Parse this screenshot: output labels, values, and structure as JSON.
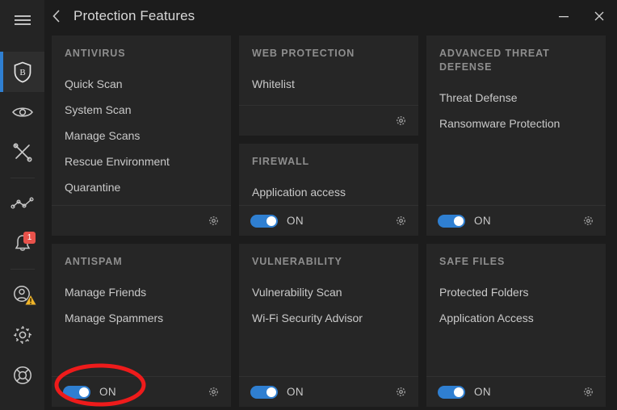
{
  "window": {
    "title": "Protection Features",
    "back_icon": "chevron-left-icon",
    "minimize_label": "—",
    "close_label": "✕",
    "bg_color": "#1c1c1c",
    "card_color": "#262626",
    "accent_color": "#2f7fd1",
    "annotation_color": "#ee1b1b"
  },
  "sidebar": {
    "menu_icon": "hamburger-menu-icon",
    "items": [
      {
        "name": "protection",
        "icon": "shield-b-icon",
        "active": true
      },
      {
        "name": "privacy",
        "icon": "eye-icon",
        "active": false
      },
      {
        "name": "utilities",
        "icon": "tools-icon",
        "active": false
      },
      {
        "name": "reports",
        "icon": "activity-chart-icon",
        "active": false
      },
      {
        "name": "notifications",
        "icon": "bell-icon",
        "active": false,
        "badge": "1"
      },
      {
        "name": "account",
        "icon": "account-warning-icon",
        "active": false
      },
      {
        "name": "settings",
        "icon": "gear-icon",
        "active": false
      },
      {
        "name": "support",
        "icon": "lifebuoy-icon",
        "active": false
      }
    ]
  },
  "cards": {
    "antivirus": {
      "title": "ANTIVIRUS",
      "links": [
        "Quick Scan",
        "System Scan",
        "Manage Scans",
        "Rescue Environment",
        "Quarantine"
      ],
      "has_toggle": false,
      "settings_icon": "gear-icon"
    },
    "antispam": {
      "title": "ANTISPAM",
      "links": [
        "Manage Friends",
        "Manage Spammers"
      ],
      "has_toggle": true,
      "toggle_state": "ON",
      "settings_icon": "gear-icon"
    },
    "web_protection": {
      "title": "WEB PROTECTION",
      "links": [
        "Whitelist"
      ],
      "has_toggle": false,
      "settings_icon": "gear-icon"
    },
    "firewall": {
      "title": "FIREWALL",
      "links": [
        "Application access"
      ],
      "has_toggle": true,
      "toggle_state": "ON",
      "settings_icon": "gear-icon"
    },
    "vulnerability": {
      "title": "VULNERABILITY",
      "links": [
        "Vulnerability Scan",
        "Wi-Fi Security Advisor"
      ],
      "has_toggle": true,
      "toggle_state": "ON",
      "settings_icon": "gear-icon"
    },
    "advanced_threat_defense": {
      "title": "ADVANCED THREAT DEFENSE",
      "links": [
        "Threat Defense",
        "Ransomware Protection"
      ],
      "has_toggle": true,
      "toggle_state": "ON",
      "settings_icon": "gear-icon"
    },
    "safe_files": {
      "title": "SAFE FILES",
      "links": [
        "Protected Folders",
        "Application Access"
      ],
      "has_toggle": true,
      "toggle_state": "ON",
      "settings_icon": "gear-icon"
    }
  },
  "annotation": {
    "shape": "ellipse",
    "target": "antispam-toggle"
  }
}
